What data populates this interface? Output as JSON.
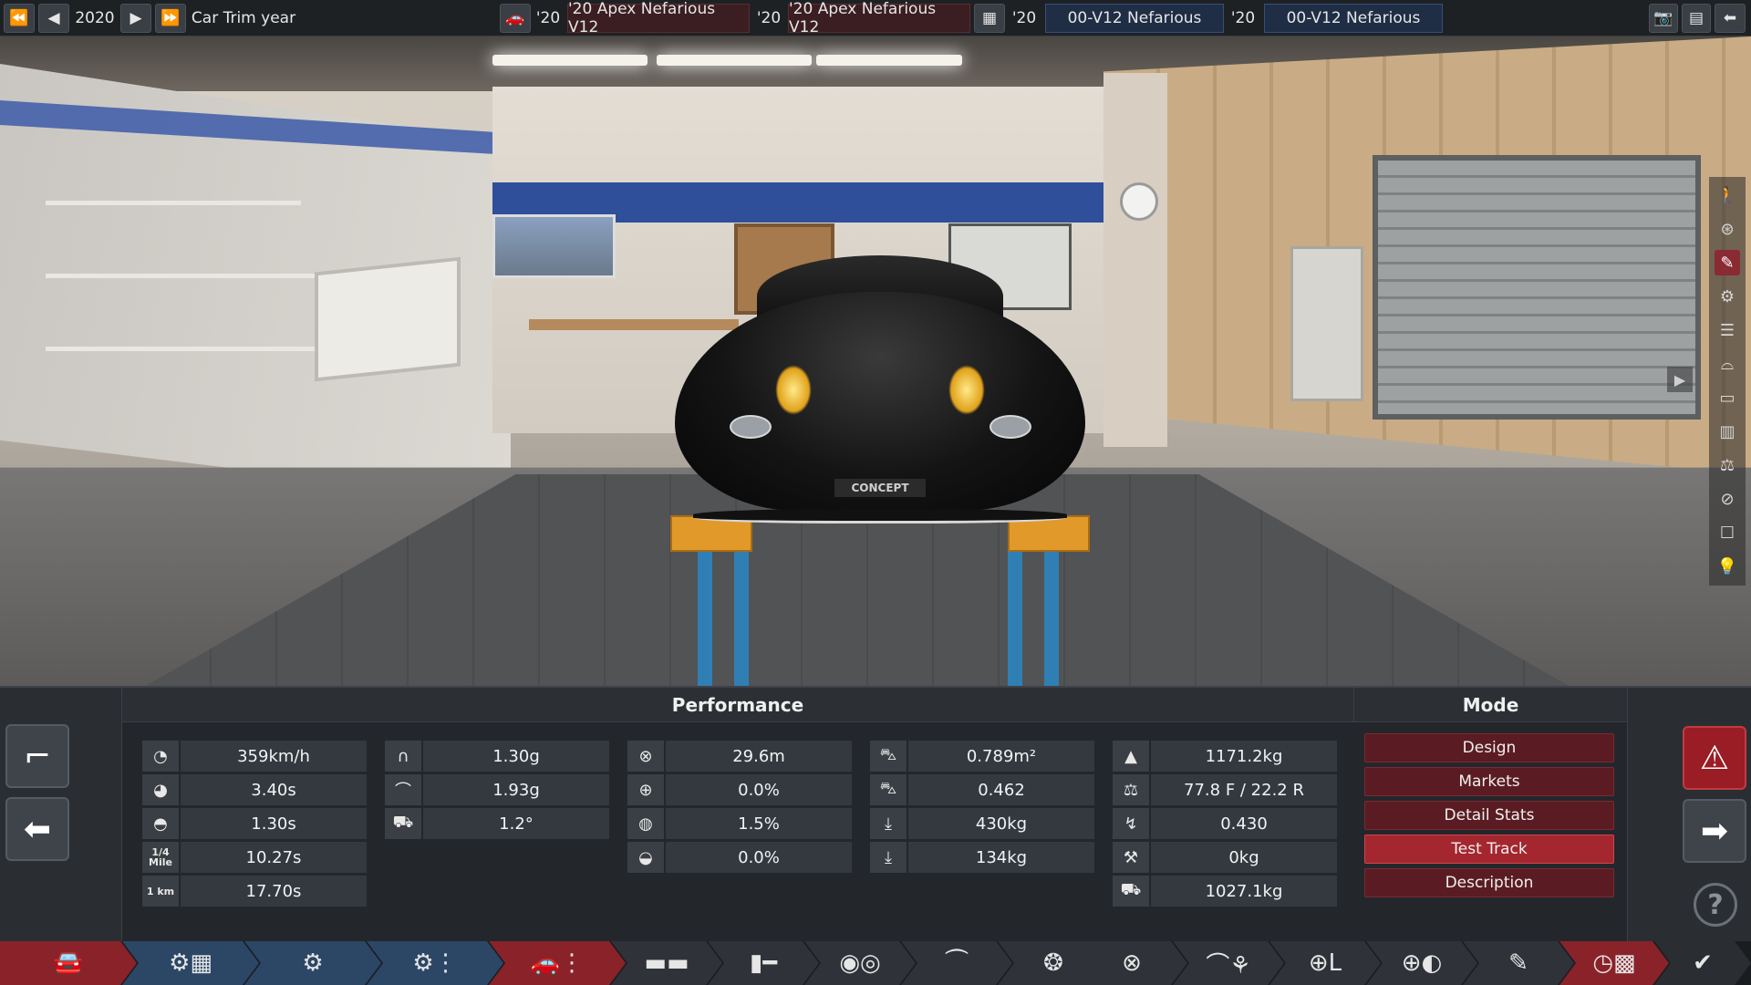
{
  "topbar": {
    "year": "2020",
    "year_label": "Car Trim year",
    "slot1": {
      "year": "'20",
      "name": "'20 Apex Nefarious V12"
    },
    "slot2": {
      "year": "'20",
      "name": "'20 Apex Nefarious V12"
    },
    "slot3": {
      "year": "'20",
      "name": "00-V12 Nefarious"
    },
    "slot4": {
      "year": "'20",
      "name": "00-V12 Nefarious"
    }
  },
  "scene": {
    "plate_text": "CONCEPT"
  },
  "panel": {
    "performance_title": "Performance",
    "mode_title": "Mode",
    "col1": [
      {
        "icon": "speedometer-icon",
        "value": "359km/h"
      },
      {
        "icon": "acceleration-gauge-icon",
        "value": "3.40s"
      },
      {
        "icon": "shift-gauge-icon",
        "value": "1.30s"
      },
      {
        "icon": "quarter-mile-icon",
        "label": "1/4 Mile",
        "value": "10.27s"
      },
      {
        "icon": "kilometer-icon",
        "label": "1 km",
        "value": "17.70s"
      }
    ],
    "col2": [
      {
        "icon": "cornering-grip-icon",
        "value": "1.30g"
      },
      {
        "icon": "lateral-grip-icon",
        "value": "1.93g"
      },
      {
        "icon": "body-roll-icon",
        "value": "1.2°"
      }
    ],
    "col3": [
      {
        "icon": "braking-distance-icon",
        "value": "29.6m"
      },
      {
        "icon": "brake-fade-icon",
        "value": "0.0%"
      },
      {
        "icon": "brake-balance-icon",
        "value": "1.5%"
      },
      {
        "icon": "brake-lock-icon",
        "value": "0.0%"
      }
    ],
    "col4": [
      {
        "icon": "frontal-area-icon",
        "value": "0.789m²"
      },
      {
        "icon": "drag-coefficient-icon",
        "value": "0.462"
      },
      {
        "icon": "downforce-front-icon",
        "value": "430kg"
      },
      {
        "icon": "downforce-rear-icon",
        "value": "134kg"
      }
    ],
    "col5": [
      {
        "icon": "weight-icon",
        "value": "1171.2kg"
      },
      {
        "icon": "weight-distribution-icon",
        "value": "77.8 F / 22.2 R"
      },
      {
        "icon": "center-of-mass-icon",
        "value": "0.430"
      },
      {
        "icon": "towing-icon",
        "value": "0kg"
      },
      {
        "icon": "cargo-capacity-icon",
        "value": "1027.1kg"
      }
    ],
    "modes": [
      "Design",
      "Markets",
      "Detail Stats",
      "Test Track",
      "Description"
    ],
    "selected_mode": "Test Track"
  },
  "toolbar": {
    "tabs": [
      "car-model-icon",
      "engine-family-icon",
      "engine-icon",
      "engine-tune-icon",
      "car-trim-icon",
      "body-icon",
      "chassis-icon",
      "suspension-icon",
      "drivetrain-icon",
      "wheels-icon",
      "brakes-icon",
      "aero-icon",
      "interior-icon",
      "safety-icon",
      "fuel-system-icon",
      "testing-icon",
      "finish-icon"
    ]
  },
  "colors": {
    "accent_red": "#a4262f",
    "panel_bg": "#23272b",
    "slot_blue": "#1f2e45"
  }
}
